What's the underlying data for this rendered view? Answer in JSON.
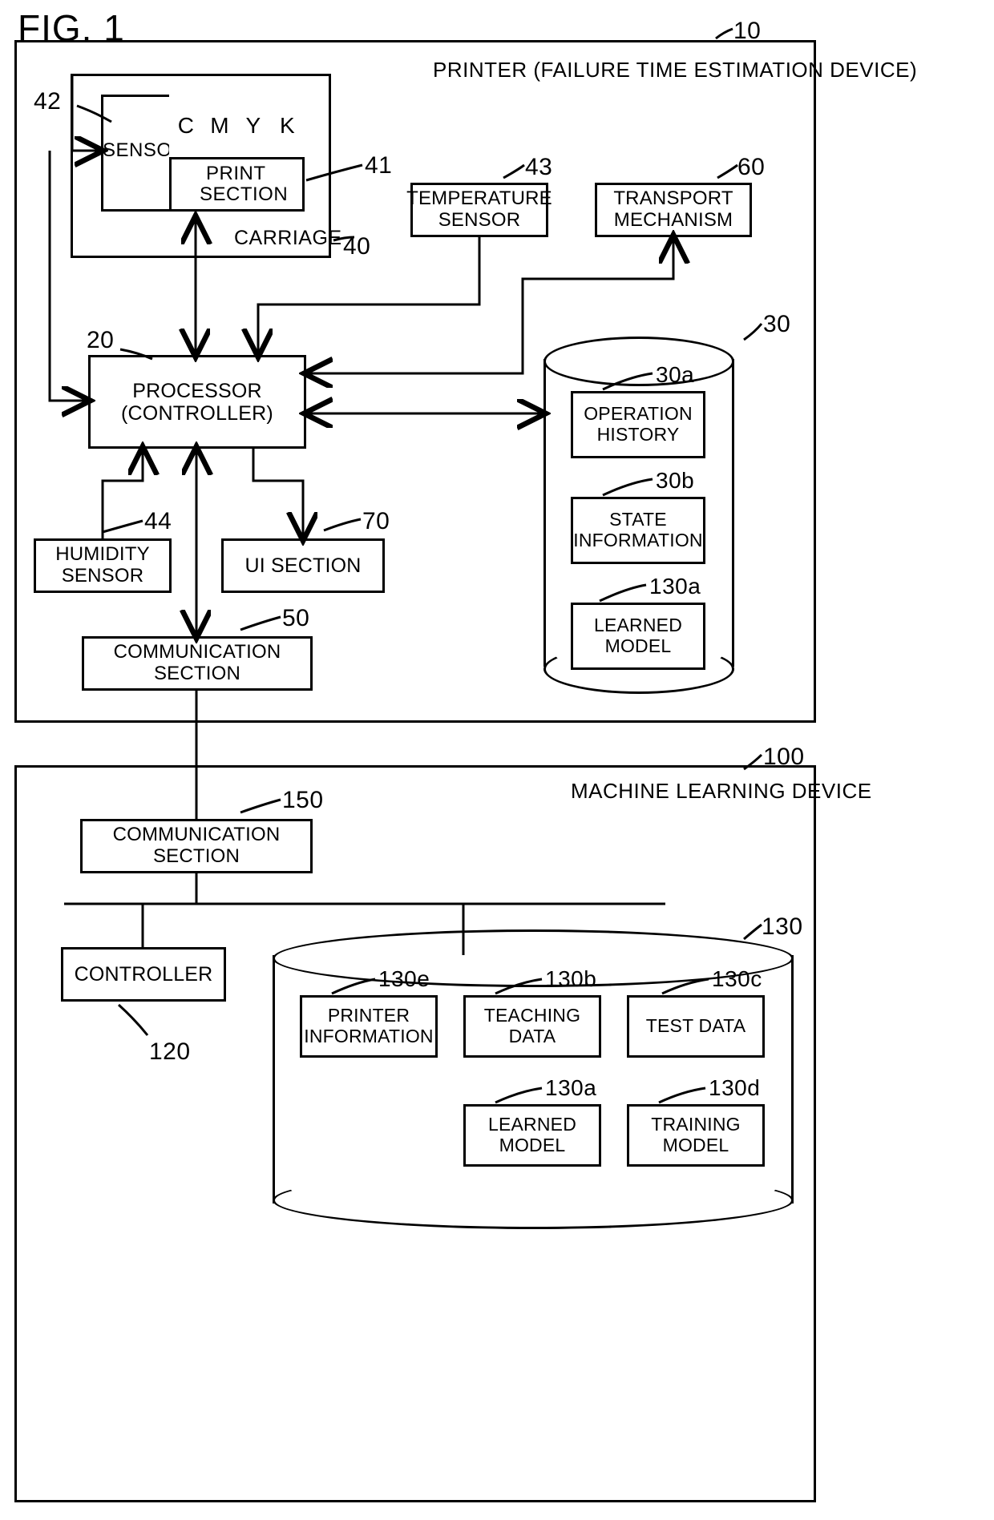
{
  "figure": {
    "title": "FIG. 1"
  },
  "printer_panel": {
    "title": "PRINTER (FAILURE TIME ESTIMATION DEVICE)",
    "ref": "10",
    "carriage": {
      "label": "CARRIAGE",
      "ref": "40",
      "sensor": {
        "label": "SENSOR",
        "ref": "42"
      },
      "print_section": {
        "label": "PRINT SECTION",
        "label_line1": "PRINT",
        "label_line2": "SECTION",
        "ref": "41",
        "inks": [
          "C",
          "M",
          "Y",
          "K"
        ]
      }
    },
    "temperature_sensor": {
      "label_line1": "TEMPERATURE",
      "label_line2": "SENSOR",
      "ref": "43"
    },
    "transport_mechanism": {
      "label_line1": "TRANSPORT",
      "label_line2": "MECHANISM",
      "ref": "60"
    },
    "processor": {
      "label_line1": "PROCESSOR",
      "label_line2": "(CONTROLLER)",
      "ref": "20"
    },
    "humidity_sensor": {
      "label_line1": "HUMIDITY",
      "label_line2": "SENSOR",
      "ref": "44"
    },
    "ui_section": {
      "label": "UI SECTION",
      "ref": "70"
    },
    "communication_section": {
      "label_line1": "COMMUNICATION",
      "label_line2": "SECTION",
      "ref": "50"
    },
    "storage": {
      "ref": "30",
      "items": [
        {
          "label_line1": "OPERATION",
          "label_line2": "HISTORY",
          "ref": "30a"
        },
        {
          "label_line1": "STATE",
          "label_line2": "INFORMATION",
          "ref": "30b"
        },
        {
          "label_line1": "LEARNED",
          "label_line2": "MODEL",
          "ref": "130a"
        }
      ]
    }
  },
  "ml_panel": {
    "title": "MACHINE LEARNING DEVICE",
    "ref": "100",
    "communication_section": {
      "label_line1": "COMMUNICATION",
      "label_line2": "SECTION",
      "ref": "150"
    },
    "controller": {
      "label": "CONTROLLER",
      "ref": "120"
    },
    "storage": {
      "ref": "130",
      "items": [
        {
          "label_line1": "PRINTER",
          "label_line2": "INFORMATION",
          "ref": "130e"
        },
        {
          "label_line1": "TEACHING",
          "label_line2": "DATA",
          "ref": "130b"
        },
        {
          "label_line1": "TEST DATA",
          "label_line2": "",
          "ref": "130c"
        },
        {
          "label_line1": "LEARNED",
          "label_line2": "MODEL",
          "ref": "130a"
        },
        {
          "label_line1": "TRAINING",
          "label_line2": "MODEL",
          "ref": "130d"
        }
      ]
    }
  },
  "colors": {
    "ink": "#000000",
    "background": "#ffffff"
  }
}
